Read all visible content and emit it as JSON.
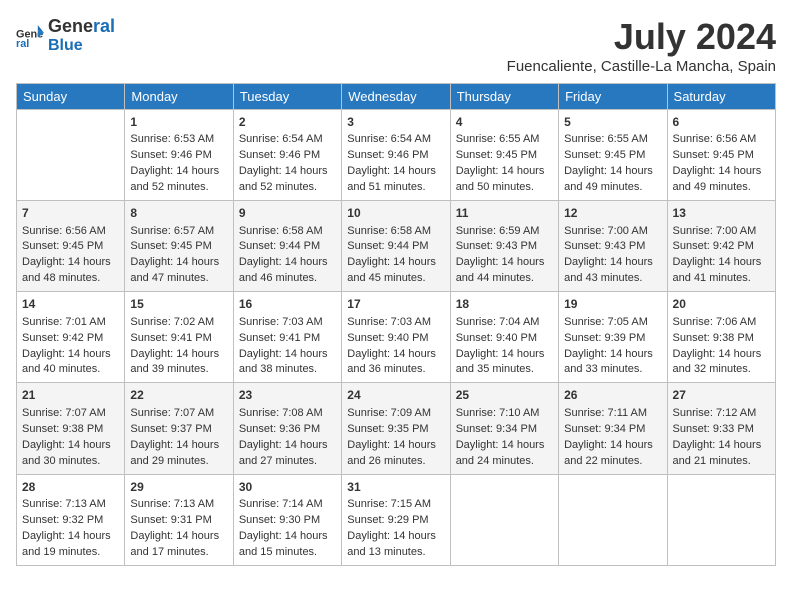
{
  "logo": {
    "general": "General",
    "blue": "Blue"
  },
  "title": "July 2024",
  "location": "Fuencaliente, Castille-La Mancha, Spain",
  "days_of_week": [
    "Sunday",
    "Monday",
    "Tuesday",
    "Wednesday",
    "Thursday",
    "Friday",
    "Saturday"
  ],
  "weeks": [
    [
      {
        "day": "",
        "content": ""
      },
      {
        "day": "1",
        "content": "Sunrise: 6:53 AM\nSunset: 9:46 PM\nDaylight: 14 hours\nand 52 minutes."
      },
      {
        "day": "2",
        "content": "Sunrise: 6:54 AM\nSunset: 9:46 PM\nDaylight: 14 hours\nand 52 minutes."
      },
      {
        "day": "3",
        "content": "Sunrise: 6:54 AM\nSunset: 9:46 PM\nDaylight: 14 hours\nand 51 minutes."
      },
      {
        "day": "4",
        "content": "Sunrise: 6:55 AM\nSunset: 9:45 PM\nDaylight: 14 hours\nand 50 minutes."
      },
      {
        "day": "5",
        "content": "Sunrise: 6:55 AM\nSunset: 9:45 PM\nDaylight: 14 hours\nand 49 minutes."
      },
      {
        "day": "6",
        "content": "Sunrise: 6:56 AM\nSunset: 9:45 PM\nDaylight: 14 hours\nand 49 minutes."
      }
    ],
    [
      {
        "day": "7",
        "content": "Sunrise: 6:56 AM\nSunset: 9:45 PM\nDaylight: 14 hours\nand 48 minutes."
      },
      {
        "day": "8",
        "content": "Sunrise: 6:57 AM\nSunset: 9:45 PM\nDaylight: 14 hours\nand 47 minutes."
      },
      {
        "day": "9",
        "content": "Sunrise: 6:58 AM\nSunset: 9:44 PM\nDaylight: 14 hours\nand 46 minutes."
      },
      {
        "day": "10",
        "content": "Sunrise: 6:58 AM\nSunset: 9:44 PM\nDaylight: 14 hours\nand 45 minutes."
      },
      {
        "day": "11",
        "content": "Sunrise: 6:59 AM\nSunset: 9:43 PM\nDaylight: 14 hours\nand 44 minutes."
      },
      {
        "day": "12",
        "content": "Sunrise: 7:00 AM\nSunset: 9:43 PM\nDaylight: 14 hours\nand 43 minutes."
      },
      {
        "day": "13",
        "content": "Sunrise: 7:00 AM\nSunset: 9:42 PM\nDaylight: 14 hours\nand 41 minutes."
      }
    ],
    [
      {
        "day": "14",
        "content": "Sunrise: 7:01 AM\nSunset: 9:42 PM\nDaylight: 14 hours\nand 40 minutes."
      },
      {
        "day": "15",
        "content": "Sunrise: 7:02 AM\nSunset: 9:41 PM\nDaylight: 14 hours\nand 39 minutes."
      },
      {
        "day": "16",
        "content": "Sunrise: 7:03 AM\nSunset: 9:41 PM\nDaylight: 14 hours\nand 38 minutes."
      },
      {
        "day": "17",
        "content": "Sunrise: 7:03 AM\nSunset: 9:40 PM\nDaylight: 14 hours\nand 36 minutes."
      },
      {
        "day": "18",
        "content": "Sunrise: 7:04 AM\nSunset: 9:40 PM\nDaylight: 14 hours\nand 35 minutes."
      },
      {
        "day": "19",
        "content": "Sunrise: 7:05 AM\nSunset: 9:39 PM\nDaylight: 14 hours\nand 33 minutes."
      },
      {
        "day": "20",
        "content": "Sunrise: 7:06 AM\nSunset: 9:38 PM\nDaylight: 14 hours\nand 32 minutes."
      }
    ],
    [
      {
        "day": "21",
        "content": "Sunrise: 7:07 AM\nSunset: 9:38 PM\nDaylight: 14 hours\nand 30 minutes."
      },
      {
        "day": "22",
        "content": "Sunrise: 7:07 AM\nSunset: 9:37 PM\nDaylight: 14 hours\nand 29 minutes."
      },
      {
        "day": "23",
        "content": "Sunrise: 7:08 AM\nSunset: 9:36 PM\nDaylight: 14 hours\nand 27 minutes."
      },
      {
        "day": "24",
        "content": "Sunrise: 7:09 AM\nSunset: 9:35 PM\nDaylight: 14 hours\nand 26 minutes."
      },
      {
        "day": "25",
        "content": "Sunrise: 7:10 AM\nSunset: 9:34 PM\nDaylight: 14 hours\nand 24 minutes."
      },
      {
        "day": "26",
        "content": "Sunrise: 7:11 AM\nSunset: 9:34 PM\nDaylight: 14 hours\nand 22 minutes."
      },
      {
        "day": "27",
        "content": "Sunrise: 7:12 AM\nSunset: 9:33 PM\nDaylight: 14 hours\nand 21 minutes."
      }
    ],
    [
      {
        "day": "28",
        "content": "Sunrise: 7:13 AM\nSunset: 9:32 PM\nDaylight: 14 hours\nand 19 minutes."
      },
      {
        "day": "29",
        "content": "Sunrise: 7:13 AM\nSunset: 9:31 PM\nDaylight: 14 hours\nand 17 minutes."
      },
      {
        "day": "30",
        "content": "Sunrise: 7:14 AM\nSunset: 9:30 PM\nDaylight: 14 hours\nand 15 minutes."
      },
      {
        "day": "31",
        "content": "Sunrise: 7:15 AM\nSunset: 9:29 PM\nDaylight: 14 hours\nand 13 minutes."
      },
      {
        "day": "",
        "content": ""
      },
      {
        "day": "",
        "content": ""
      },
      {
        "day": "",
        "content": ""
      }
    ]
  ]
}
